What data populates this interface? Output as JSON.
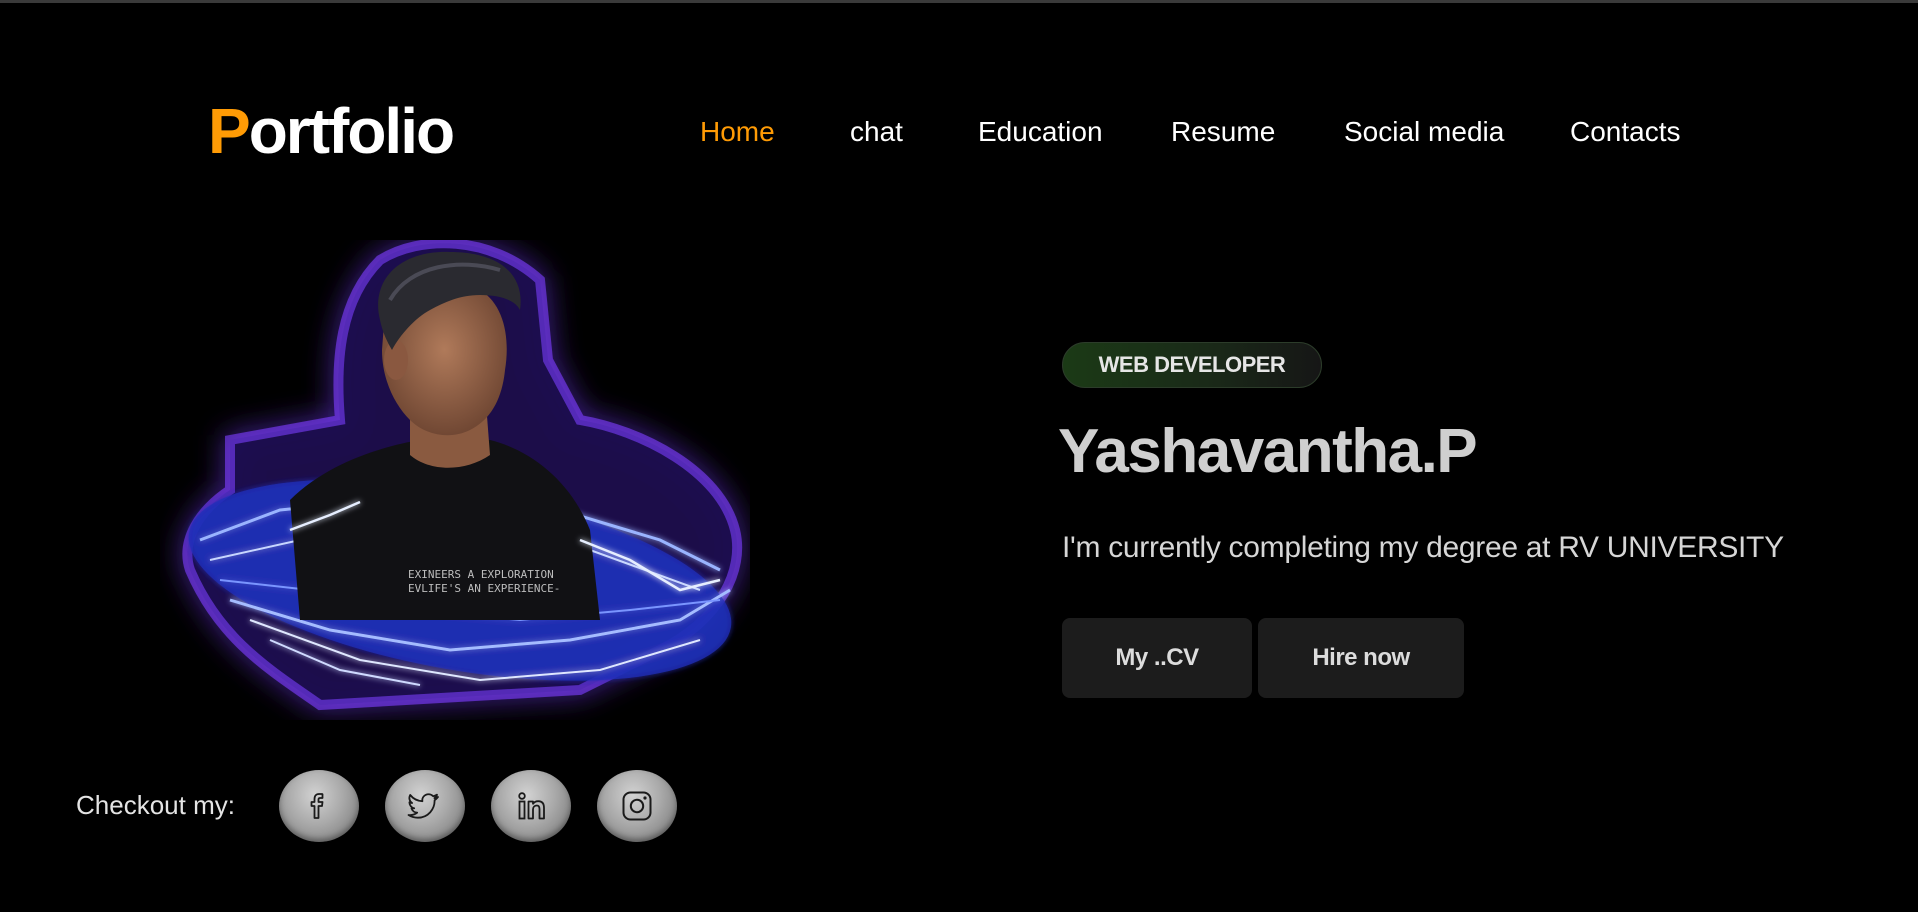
{
  "logo": {
    "first_letter": "P",
    "rest": "ortfolio"
  },
  "nav": {
    "items": [
      {
        "label": "Home",
        "active": true
      },
      {
        "label": "chat",
        "active": false
      },
      {
        "label": "Education",
        "active": false
      },
      {
        "label": "Resume",
        "active": false
      },
      {
        "label": "Social media",
        "active": false
      },
      {
        "label": "Contacts",
        "active": false
      }
    ]
  },
  "hero": {
    "role": "WEB DEVELOPER",
    "name": "Yashavantha.P",
    "description": "I'm currently completing my degree at RV UNIVERSITY",
    "buttons": {
      "cv_label": "My ..CV",
      "hire_label": "Hire now"
    },
    "portrait_shirt_text": [
      "EXINEERS A EXPLORATION",
      "EVLIFE'S AN EXPERIENCE-"
    ]
  },
  "socials": {
    "label": "Checkout my:",
    "icons": [
      "facebook-icon",
      "twitter-icon",
      "linkedin-icon",
      "instagram-icon"
    ]
  },
  "colors": {
    "background": "#000000",
    "accent": "#ff9b05",
    "button_bg": "#1c1c1c",
    "badge_green": "#1b3a16",
    "glow_purple": "#8a3cff",
    "lightning_blue": "#3a5bff"
  }
}
